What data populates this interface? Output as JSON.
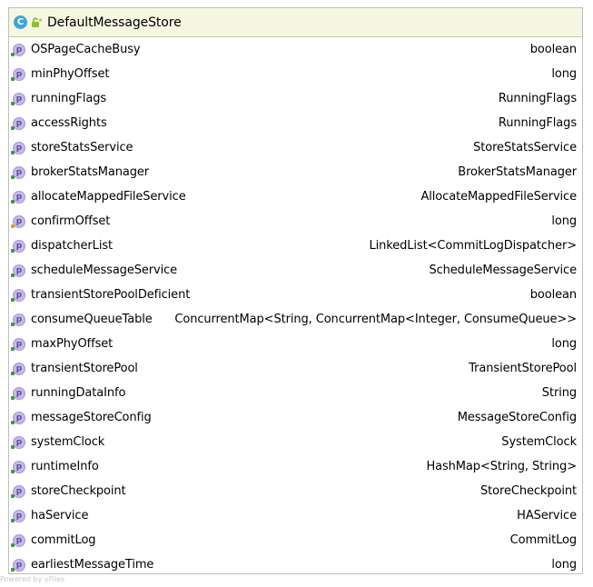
{
  "diagram": {
    "class": {
      "kind_badge": "C",
      "name": "DefaultMessageStore"
    },
    "fields": [
      {
        "badge": "p",
        "name": "OSPageCacheBusy",
        "type": "boolean",
        "visibility_color": "#3c9a3c"
      },
      {
        "badge": "p",
        "name": "minPhyOffset",
        "type": "long",
        "visibility_color": "#3c9a3c"
      },
      {
        "badge": "p",
        "name": "runningFlags",
        "type": "RunningFlags",
        "visibility_color": "#3c9a3c"
      },
      {
        "badge": "p",
        "name": "accessRights",
        "type": "RunningFlags",
        "visibility_color": "#3c9a3c"
      },
      {
        "badge": "p",
        "name": "storeStatsService",
        "type": "StoreStatsService",
        "visibility_color": "#3c9a3c"
      },
      {
        "badge": "p",
        "name": "brokerStatsManager",
        "type": "BrokerStatsManager",
        "visibility_color": "#3c9a3c"
      },
      {
        "badge": "p",
        "name": "allocateMappedFileService",
        "type": "AllocateMappedFileService",
        "visibility_color": "#3c9a3c"
      },
      {
        "badge": "p",
        "name": "confirmOffset",
        "type": "long",
        "visibility_color": "#e0a020"
      },
      {
        "badge": "p",
        "name": "dispatcherList",
        "type": "LinkedList<CommitLogDispatcher>",
        "visibility_color": "#3c9a3c"
      },
      {
        "badge": "p",
        "name": "scheduleMessageService",
        "type": "ScheduleMessageService",
        "visibility_color": "#3c9a3c"
      },
      {
        "badge": "p",
        "name": "transientStorePoolDeficient",
        "type": "boolean",
        "visibility_color": "#3c9a3c"
      },
      {
        "badge": "p",
        "name": "consumeQueueTable",
        "type": "ConcurrentMap<String, ConcurrentMap<Integer, ConsumeQueue>>",
        "visibility_color": "#3c9a3c"
      },
      {
        "badge": "p",
        "name": "maxPhyOffset",
        "type": "long",
        "visibility_color": "#3c9a3c"
      },
      {
        "badge": "p",
        "name": "transientStorePool",
        "type": "TransientStorePool",
        "visibility_color": "#3c9a3c"
      },
      {
        "badge": "p",
        "name": "runningDataInfo",
        "type": "String",
        "visibility_color": "#3c9a3c"
      },
      {
        "badge": "p",
        "name": "messageStoreConfig",
        "type": "MessageStoreConfig",
        "visibility_color": "#3c9a3c"
      },
      {
        "badge": "p",
        "name": "systemClock",
        "type": "SystemClock",
        "visibility_color": "#3c9a3c"
      },
      {
        "badge": "p",
        "name": "runtimeInfo",
        "type": "HashMap<String, String>",
        "visibility_color": "#3c9a3c"
      },
      {
        "badge": "p",
        "name": "storeCheckpoint",
        "type": "StoreCheckpoint",
        "visibility_color": "#3c9a3c"
      },
      {
        "badge": "p",
        "name": "haService",
        "type": "HAService",
        "visibility_color": "#3c9a3c"
      },
      {
        "badge": "p",
        "name": "commitLog",
        "type": "CommitLog",
        "visibility_color": "#3c9a3c"
      },
      {
        "badge": "p",
        "name": "earliestMessageTime",
        "type": "long",
        "visibility_color": "#3c9a3c"
      }
    ]
  },
  "watermark": "Powered by yFiles",
  "colors": {
    "header_bg": "#f6f7e1",
    "class_badge": "#3ea7d6",
    "property_badge": "#c7b8e9",
    "public_green": "#3c9a3c",
    "package_orange": "#e0a020"
  },
  "icons": {
    "class_badge": "class-c-icon",
    "public_modifier": "public-lock-icon",
    "field_badge": "property-p-icon"
  }
}
